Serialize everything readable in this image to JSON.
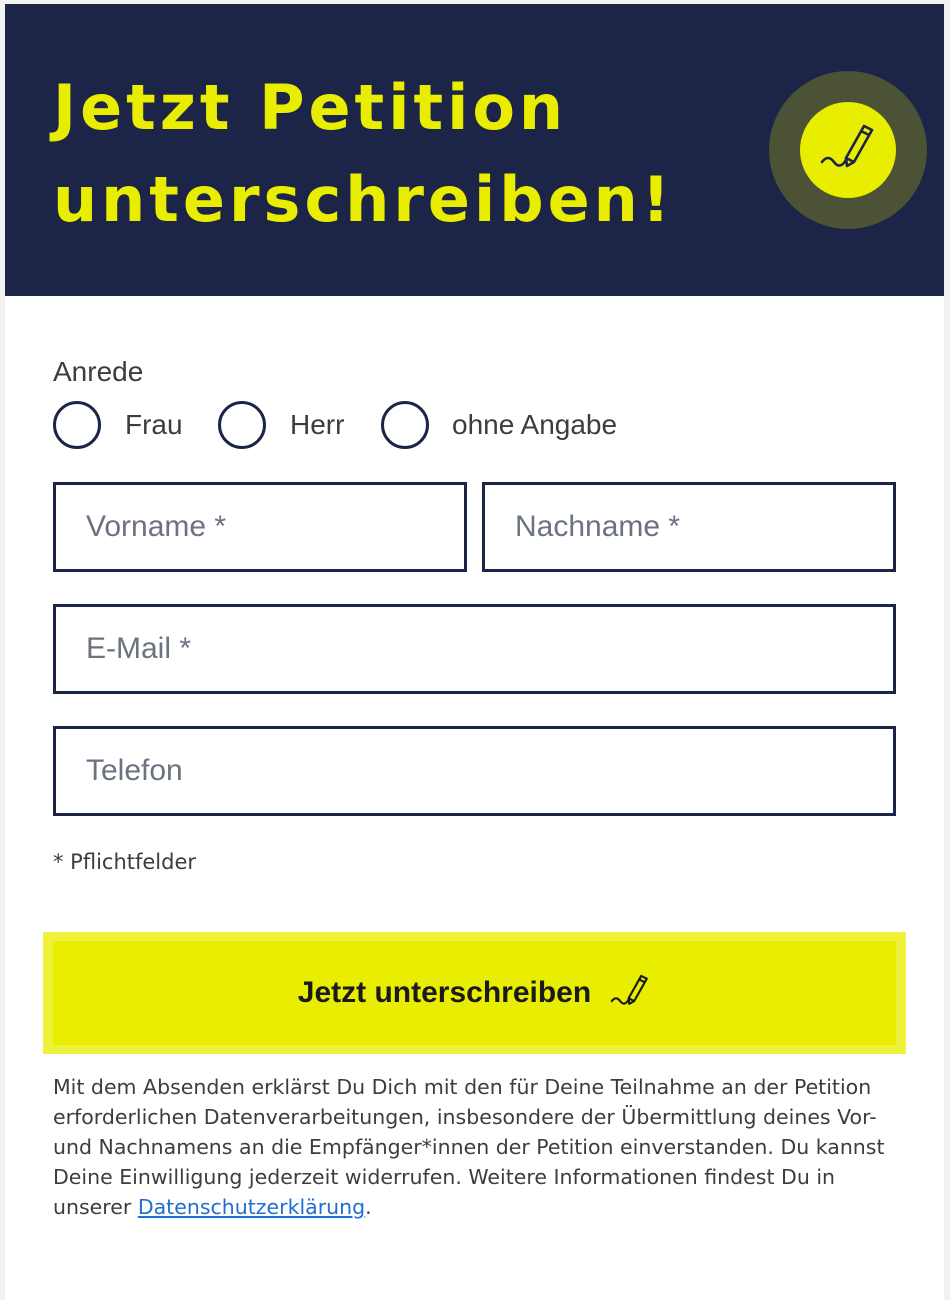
{
  "header": {
    "title": "Jetzt Petition unterschreiben!",
    "icon": "signature-pen-icon",
    "bg_color": "#1c2447",
    "accent_color": "#e9ed00"
  },
  "form": {
    "salutation": {
      "label": "Anrede",
      "options": [
        "Frau",
        "Herr",
        "ohne Angabe"
      ]
    },
    "fields": {
      "first_name_placeholder": "Vorname *",
      "last_name_placeholder": "Nachname *",
      "email_placeholder": "E-Mail *",
      "phone_placeholder": "Telefon"
    },
    "required_note": "* Pflichtfelder",
    "submit_label": "Jetzt unterschreiben",
    "submit_icon": "signature-pen-icon"
  },
  "consent": {
    "text": "Mit dem Absenden erklärst Du Dich mit den für Deine Teilnahme an der Petition erforderlichen Datenverarbeitungen, insbesondere der Übermittlung deines Vor- und Nachnamens an die Empfänger*innen der Petition einverstanden. Du kannst Deine Einwilligung jederzeit widerrufen. Weitere Informationen findest Du in unserer ",
    "link_text": "Datenschutzerklärung",
    "suffix": "."
  }
}
